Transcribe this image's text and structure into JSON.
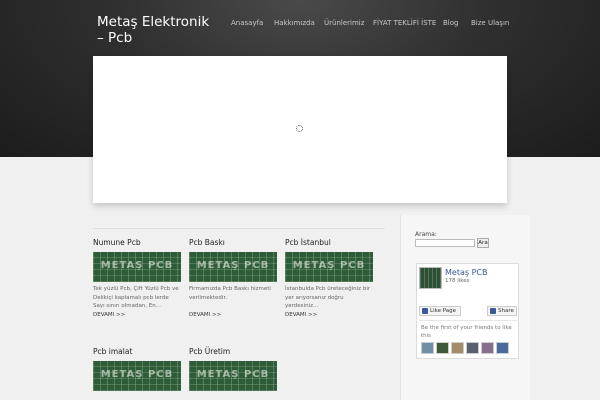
{
  "site": {
    "title": "Metaş Elektronik – Pcb"
  },
  "nav": {
    "items": [
      "Anasayfa",
      "Hakkımızda",
      "Ürünlerimiz",
      "FİYAT TEKLİFİ İSTE",
      "Blog",
      "Bize Ulaşın"
    ]
  },
  "posts": [
    {
      "title": "Numune Pcb",
      "thumb_text": "METAŞ PCB",
      "excerpt": "Tek yüzlü Pcb, Çift Yüzlü Pcb ve Delikiçi kaplamalı pcb lerde Sayı sınırı olmadan, En...",
      "more": "DEVAMI >>"
    },
    {
      "title": "Pcb Baskı",
      "thumb_text": "METAŞ PCB",
      "excerpt": "Firmamızda Pcb Baskı hizmeti verilmektedir.",
      "more": "DEVAMI >>"
    },
    {
      "title": "Pcb İstanbul",
      "thumb_text": "METAŞ PCB",
      "excerpt": "İstanbulda Pcb üreteceğiniz bir yer arıyorsanız doğru yerdesiniz...",
      "more": "DEVAMI >>"
    },
    {
      "title": "Pcb imalat",
      "thumb_text": "METAŞ PCB",
      "excerpt": "",
      "more": ""
    },
    {
      "title": "Pcb Üretim",
      "thumb_text": "METAŞ PCB",
      "excerpt": "",
      "more": ""
    }
  ],
  "sidebar": {
    "search_label": "Arama:",
    "search_value": "",
    "search_button": "Ara"
  },
  "facebook": {
    "page_name": "Metaş PCB",
    "likes": "178 likes",
    "like_button": "Like Page",
    "share_button": "Share",
    "friends_text": "Be the first of your friends to like this",
    "avatar_colors": [
      "#6f8fa6",
      "#3d5a3b",
      "#a48b6a",
      "#58606e",
      "#8a6d8c",
      "#4a6a9a"
    ]
  },
  "colors": {
    "header_bg": "#2f2f2f",
    "link_blue": "#3b5998",
    "thumb_green": "#2f5c38"
  }
}
